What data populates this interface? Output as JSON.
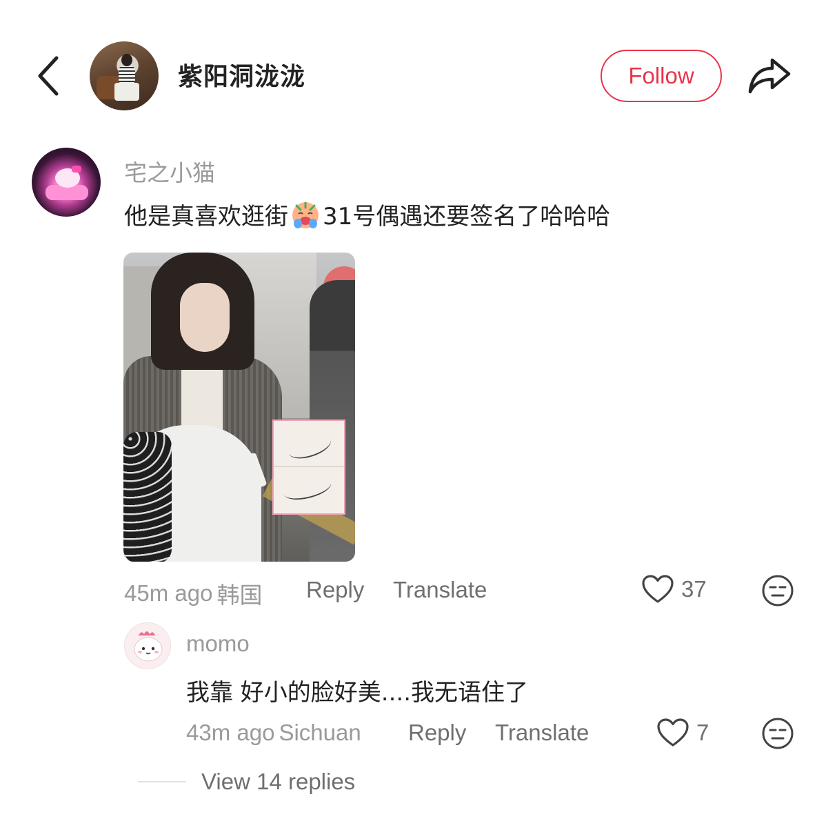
{
  "header": {
    "back_icon": "chevron-left-icon",
    "author_name": "紫阳洞泷泷",
    "follow_label": "Follow",
    "share_icon": "share-arrow-icon",
    "accent_color": "#e8344a"
  },
  "comment": {
    "username": "宅之小猫",
    "text_before_emoji": "他是真喜欢逛街",
    "emoji": "crying-face-emoji",
    "text_after_emoji": "31号偶遇还要签名了哈哈哈",
    "time": "45m ago",
    "location": "韩国",
    "reply_label": "Reply",
    "translate_label": "Translate",
    "like_count": "37",
    "like_icon": "heart-outline-icon",
    "reaction_icon": "neutral-face-icon"
  },
  "reply": {
    "username": "momo",
    "text": "我靠 好小的脸好美....我无语住了",
    "time": "43m ago",
    "location": "Sichuan",
    "reply_label": "Reply",
    "translate_label": "Translate",
    "like_count": "7",
    "like_icon": "heart-outline-icon",
    "reaction_icon": "neutral-face-icon"
  },
  "view_replies_label": "View 14 replies"
}
